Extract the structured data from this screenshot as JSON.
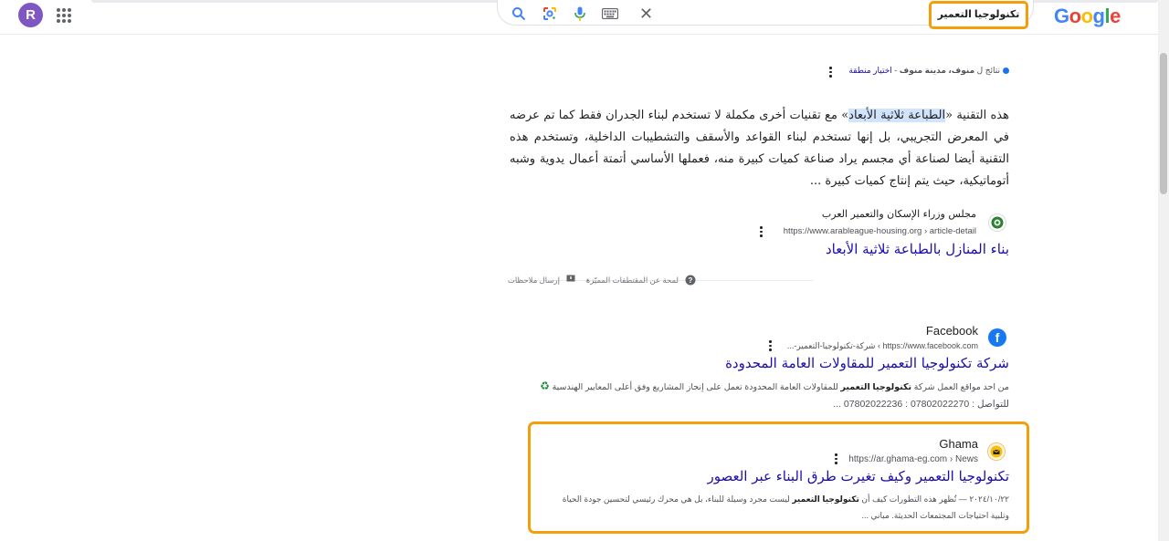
{
  "header": {
    "avatar_letter": "R",
    "search_query": "تكنولوجيا التعمير",
    "logo": [
      "G",
      "o",
      "o",
      "g",
      "l",
      "e"
    ],
    "icons": [
      "search-icon",
      "google-lens-icon",
      "microphone-icon",
      "keyboard-icon",
      "close-icon",
      "apps-grid-icon"
    ],
    "close_glyph": "✕"
  },
  "location": {
    "prefix": "نتائج ل",
    "place": "منوف، مدينة منوف",
    "separator": " - ",
    "change_link": "اختيار منطقة"
  },
  "featured_snippet": {
    "text_before": "هذه التقنية «",
    "highlight": "الطباعة ثلاثية الأبعاد",
    "text_after": "» مع تقنيات أخرى مكملة لا تستخدم لبناء الجدران فقط كما تم عرضه في المعرض التجريبي، بل إنها تستخدم لبناء القواعد والأسقف والتشطيبات الداخلية، وتستخدم هذه التقنية أيضا لصناعة أي مجسم يراد صناعة كميات كبيرة منه، فعملها الأساسي أتمتة أعمال يدوية وشبه أتوماتيكية، حيث يتم إنتاج كميات كبيرة ...",
    "site_name": "مجلس وزراء الإسكان والتعمير العرب",
    "site_url": "https://www.arableague-housing.org › article-detail",
    "title": "بناء المنازل بالطباعة ثلاثية الأبعاد"
  },
  "feedback": {
    "about_label": "لمحة عن المقتطفات المميّزة",
    "bullet": "•",
    "feedback_label": "إرسال ملاحظات"
  },
  "results": [
    {
      "site_name": "Facebook",
      "site_url": "https://www.facebook.com › شركة-تكنولوجيا-التعمير-...",
      "title": "شركة تكنولوجيا التعمير للمقاولات العامة المحدودة",
      "desc_line1_before": "من احد مواقع العمل شركة ",
      "desc_line1_bold": "تكنولوجيا التعمير",
      "desc_line1_after": " للمقاولات العامة المحدودة تعمل على إنجاز المشاريع وفق أعلى المعايير الهندسية",
      "desc_emoji": "♻",
      "desc_line2": "للتواصل : 07802022270 : 07802022236 ..."
    },
    {
      "site_name": "Ghama",
      "site_url": "https://ar.ghama-eg.com › News",
      "title": "تكنولوجيا التعمير وكيف تغيرت طرق البناء عبر العصور",
      "date": "٢٠٢٤/١٠/٢٢ —",
      "desc_before": " تُظهر هذه التطورات كيف أن ",
      "desc_bold": "تكنولوجيا التعمير",
      "desc_after": " ليست مجرد وسيلة للبناء، بل هي محرك رئيسي لتحسين جودة الحياة وتلبية احتياجات المجتمعات الحديثة. مباني ..."
    }
  ],
  "colors": {
    "link": "#1a0dab",
    "highlight": "#d2e3fc",
    "annotation_box": "#f59e0b",
    "avatar": "#7e57c2"
  }
}
